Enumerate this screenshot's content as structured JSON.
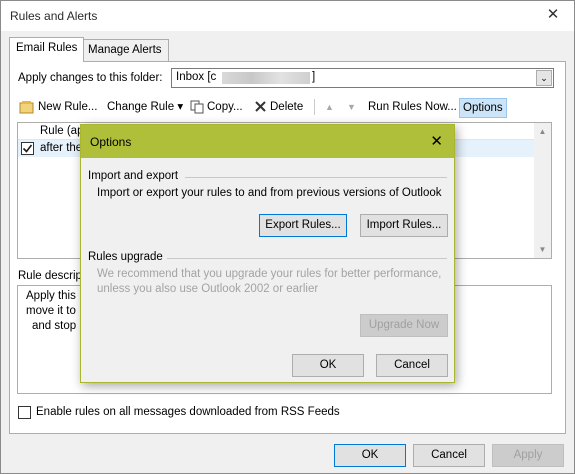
{
  "window": {
    "title": "Rules and Alerts",
    "close_glyph": "✕"
  },
  "tabs": [
    {
      "label": "Email Rules"
    },
    {
      "label": "Manage Alerts"
    }
  ],
  "folder": {
    "label": "Apply changes to this folder:",
    "value_prefix": "Inbox [c",
    "value_suffix": "]",
    "dropdown_glyph": "⌄"
  },
  "toolbar": {
    "new_rule": "New Rule...",
    "change_rule": "Change Rule ▾",
    "copy": "Copy...",
    "delete": "Delete",
    "up_glyph": "▲",
    "down_glyph": "▼",
    "run_rules_now": "Run Rules Now...",
    "options": "Options"
  },
  "rules_list": {
    "header": "Rule (ap",
    "rows": [
      {
        "name": "after the",
        "checked": true
      }
    ]
  },
  "rule_description": {
    "label": "Rule descrip",
    "lines": [
      "Apply this",
      "move it to",
      "and stop"
    ]
  },
  "rss": {
    "label": "Enable rules on all messages downloaded from RSS Feeds",
    "checked": false
  },
  "buttons": {
    "ok": "OK",
    "cancel": "Cancel",
    "apply": "Apply"
  },
  "options_dialog": {
    "title": "Options",
    "close_glyph": "✕",
    "import_export": {
      "heading": "Import and export",
      "description": "Import or export your rules to and from previous versions of Outlook",
      "export_button": "Export Rules...",
      "import_button": "Import Rules..."
    },
    "rules_upgrade": {
      "heading": "Rules upgrade",
      "line1": "We recommend that you upgrade your rules for better performance,",
      "line2": "unless you also use Outlook 2002 or earlier",
      "upgrade_button": "Upgrade Now"
    },
    "ok": "OK",
    "cancel": "Cancel"
  },
  "colors": {
    "dialog_titlebar": "#b0bf3a",
    "accent_blue": "#0078d7",
    "selection": "#cce4f7"
  }
}
